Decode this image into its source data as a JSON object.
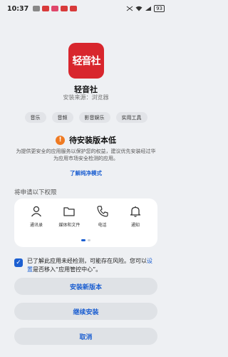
{
  "status_bar": {
    "time": "10:37",
    "battery": "93"
  },
  "app": {
    "logo_text": "轻音社",
    "name": "轻音社",
    "install_source": "安装来源：浏览器",
    "brand_color": "#d8262d"
  },
  "tags": [
    "音乐",
    "音频",
    "影音娱乐",
    "实用工具"
  ],
  "warning": {
    "icon": "exclamation-icon",
    "title": "待安装版本低",
    "description": "为提供更安全的应用服务以保护您的权益，建议优先安装经过华为应用市场安全检测的应用。",
    "link": "了解纯净模式"
  },
  "permissions": {
    "heading": "将申请以下权限",
    "items": [
      {
        "icon": "person-icon",
        "label": "通讯录"
      },
      {
        "icon": "folder-icon",
        "label": "媒体和文件"
      },
      {
        "icon": "phone-icon",
        "label": "电话"
      },
      {
        "icon": "bell-icon",
        "label": "通知"
      }
    ]
  },
  "consent": {
    "checked": true,
    "text_before": "已了解此应用未经检测，可能存在风险。您可以",
    "link": "设置",
    "text_after": "是否移入“应用管控中心”。"
  },
  "buttons": {
    "install_new": "安装新版本",
    "continue_install": "继续安装",
    "cancel": "取消"
  },
  "colors": {
    "accent": "#1c5fd1",
    "warning": "#ef7a22",
    "background": "#eef0f3"
  }
}
